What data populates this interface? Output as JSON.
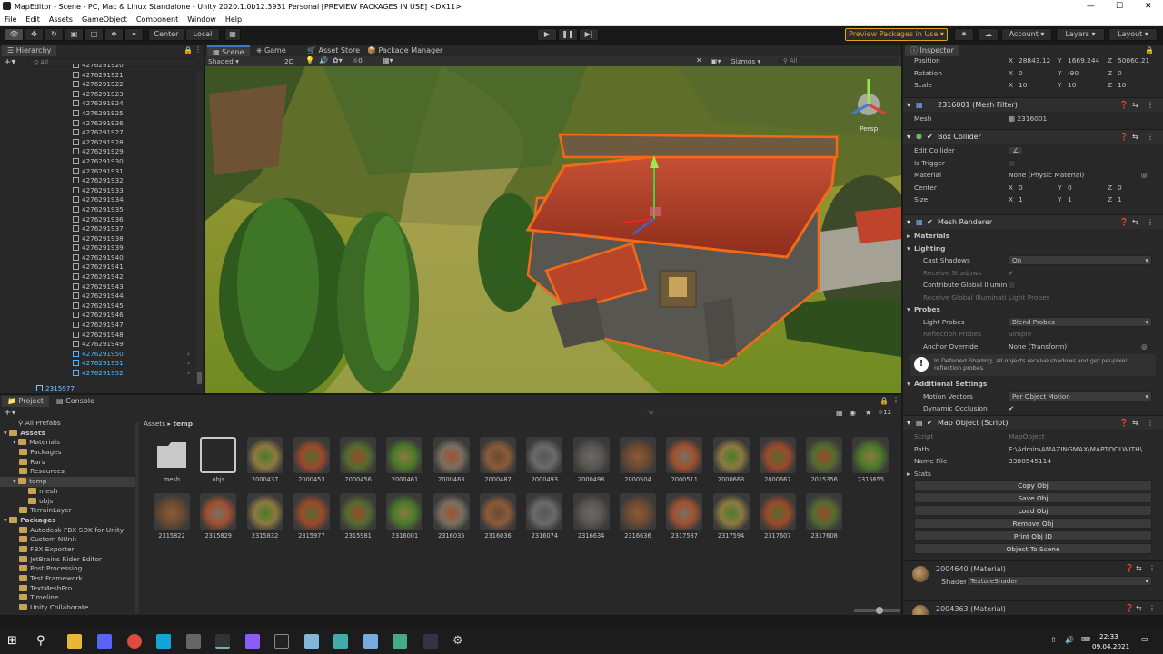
{
  "window": {
    "title": "MapEditor - Scene - PC, Mac & Linux Standalone - Unity 2020.1.0b12.3931 Personal [PREVIEW PACKAGES IN USE] <DX11>"
  },
  "menu": [
    "File",
    "Edit",
    "Assets",
    "GameObject",
    "Component",
    "Window",
    "Help"
  ],
  "toolbar": {
    "center": "Center",
    "local": "Local",
    "preview_packages": "Preview Packages in Use",
    "account": "Account",
    "layers": "Layers",
    "layout": "Layout"
  },
  "hierarchy": {
    "tab": "Hierarchy",
    "search_label": "All",
    "rows": [
      "4276291920",
      "4276291921",
      "4276291922",
      "4276291923",
      "4276291924",
      "4276291925",
      "4276291926",
      "4276291927",
      "4276291928",
      "4276291929",
      "4276291930",
      "4276291931",
      "4276291932",
      "4276291933",
      "4276291934",
      "4276291935",
      "4276291936",
      "4276291937",
      "4276291938",
      "4276291939",
      "4276291940",
      "4276291941",
      "4276291942",
      "4276291943",
      "4276291944",
      "4276291945",
      "4276291946",
      "4276291947",
      "4276291948",
      "4276291949",
      "4276291950",
      "4276291951",
      "4276291952"
    ],
    "bottom_item": "2315977"
  },
  "scene_tabs": {
    "scene": "Scene",
    "game": "Game",
    "asset_store": "Asset Store",
    "package_manager": "Package Manager"
  },
  "scene_bar": {
    "shaded": "Shaded",
    "mode_2d": "2D",
    "gizmo_count": "0",
    "gizmos": "Gizmos",
    "search_label": "All",
    "persp": "Persp"
  },
  "project": {
    "tab_project": "Project",
    "tab_console": "Console",
    "all_prefabs": "All Prefabs",
    "tree": [
      {
        "label": "Assets",
        "bold": true,
        "indent": 0
      },
      {
        "label": "Materials",
        "indent": 1
      },
      {
        "label": "Packages",
        "indent": 1
      },
      {
        "label": "Rars",
        "indent": 1
      },
      {
        "label": "Resources",
        "indent": 1
      },
      {
        "label": "temp",
        "indent": 1,
        "selected": true
      },
      {
        "label": "mesh",
        "indent": 2
      },
      {
        "label": "objs",
        "indent": 2
      },
      {
        "label": "TerrainLayer",
        "indent": 1
      },
      {
        "label": "Packages",
        "bold": true,
        "indent": 0
      },
      {
        "label": "Autodesk FBX SDK for Unity",
        "indent": 1
      },
      {
        "label": "Custom NUnit",
        "indent": 1
      },
      {
        "label": "FBX Exporter",
        "indent": 1
      },
      {
        "label": "JetBrains Rider Editor",
        "indent": 1
      },
      {
        "label": "Post Processing",
        "indent": 1
      },
      {
        "label": "Test Framework",
        "indent": 1
      },
      {
        "label": "TextMeshPro",
        "indent": 1
      },
      {
        "label": "Timeline",
        "indent": 1
      },
      {
        "label": "Unity Collaborate",
        "indent": 1
      }
    ],
    "breadcrumb": [
      "Assets",
      "temp"
    ],
    "hidden_count": "12",
    "assets_row1": [
      "mesh",
      "objs",
      "2000437",
      "2000453",
      "2000456",
      "2000461",
      "2000463",
      "2000487",
      "2000493",
      "2000498",
      "2000504",
      "2000511",
      "2000663",
      "2000667",
      "2015356",
      "2315655"
    ],
    "assets_row2": [
      "2315822",
      "2315829",
      "2315832",
      "2315977",
      "2315981",
      "2316001",
      "2316035",
      "2316036",
      "2316074",
      "2316634",
      "2316636",
      "2317587",
      "2317594",
      "2317607",
      "2317608"
    ]
  },
  "inspector": {
    "tab": "Inspector",
    "transform": {
      "position_label": "Position",
      "px": "28843.12",
      "py": "1669.244",
      "pz": "50060.21",
      "rotation_label": "Rotation",
      "rx": "0",
      "ry": "-90",
      "rz": "0",
      "scale_label": "Scale",
      "sx": "10",
      "sy": "10",
      "sz": "10"
    },
    "mesh_filter": {
      "title": "2316001 (Mesh Filter)",
      "mesh_label": "Mesh",
      "mesh_value": "2316001"
    },
    "box_collider": {
      "title": "Box Collider",
      "edit_collider": "Edit Collider",
      "is_trigger": "Is Trigger",
      "material_label": "Material",
      "material_value": "None (Physic Material)",
      "center_label": "Center",
      "cx": "0",
      "cy": "0",
      "cz": "0",
      "size_label": "Size",
      "sx": "1",
      "sy": "1",
      "sz": "1"
    },
    "mesh_renderer": {
      "title": "Mesh Renderer",
      "materials": "Materials",
      "lighting": "Lighting",
      "cast_shadows": "Cast Shadows",
      "cast_shadows_value": "On",
      "receive_shadows": "Receive Shadows",
      "contribute_gi": "Contribute Global Illumin",
      "receive_gi": "Receive Global Illuminati",
      "receive_gi_value": "Light Probes",
      "probes": "Probes",
      "light_probes": "Light Probes",
      "light_probes_value": "Blend Probes",
      "reflection_probes": "Reflection Probes",
      "reflection_probes_value": "Simple",
      "anchor_override": "Anchor Override",
      "anchor_override_value": "None (Transform)",
      "info": "In Deferred Shading, all objects receive shadows and get per-pixel reflection probes.",
      "additional": "Additional Settings",
      "motion_vectors": "Motion Vectors",
      "motion_vectors_value": "Per Object Motion",
      "dynamic_occlusion": "Dynamic Occlusion"
    },
    "map_object": {
      "title": "Map Object (Script)",
      "script_label": "Script",
      "script_value": "MapObject",
      "path_label": "Path",
      "path_value": "E:\\Admin\\AMAZINGMAX\\MAPTOOLWITH\\",
      "name_label": "Name File",
      "name_value": "3380545114",
      "stats": "Stats",
      "buttons": [
        "Copy Obj",
        "Save Obj",
        "Load Obj",
        "Remove Obj",
        "Print Obj ID",
        "Object To Scene"
      ]
    },
    "material1": {
      "title": "2004640 (Material)",
      "shader_label": "Shader",
      "shader_value": "TextureShader"
    },
    "material2": {
      "title": "2004363 (Material)"
    }
  },
  "taskbar": {
    "time": "22:33",
    "date": "09.04.2021"
  },
  "colors": {
    "accent": "#3a79c8",
    "selection": "#4fb8ff",
    "preview_border": "#e6a51d"
  }
}
